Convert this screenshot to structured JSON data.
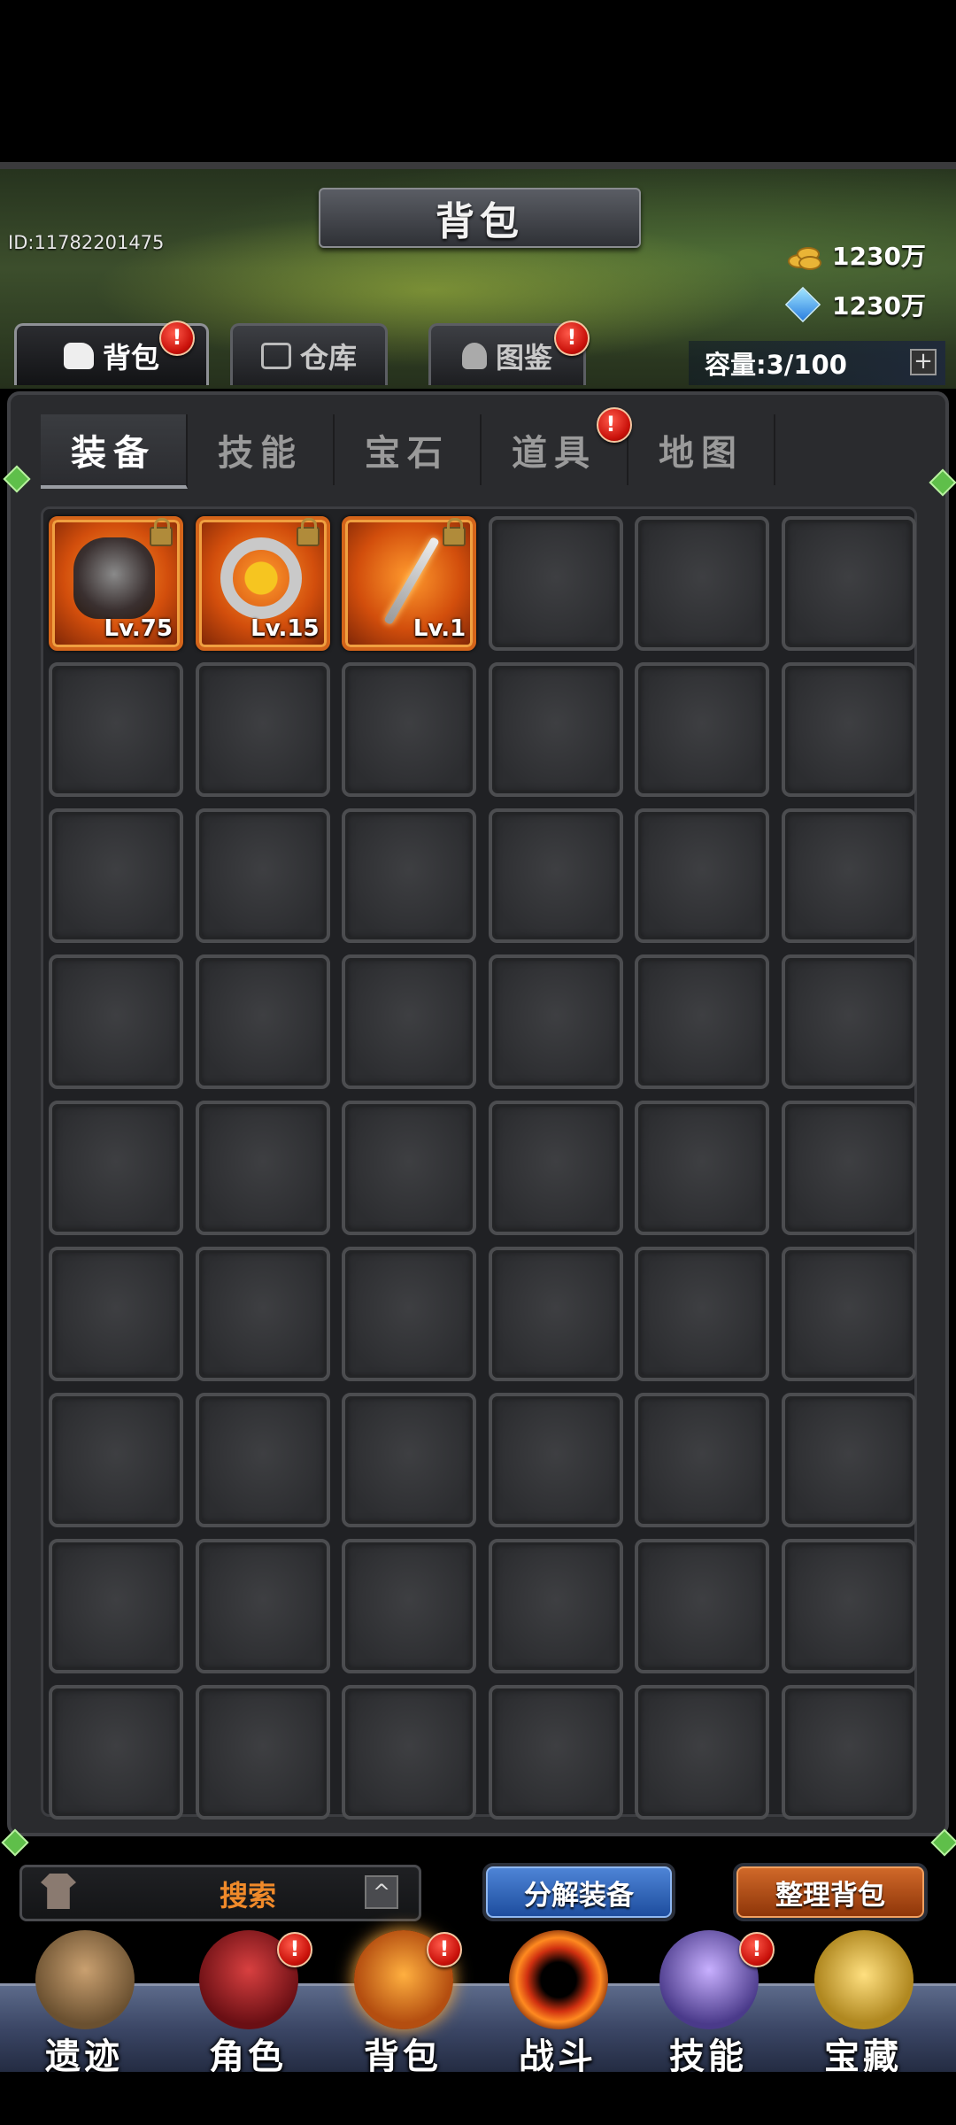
{
  "header": {
    "title": "背包",
    "user_id": "ID:11782201475",
    "gold_amount": "1230万",
    "gem_amount": "1230万",
    "capacity": "容量:3/100",
    "capacity_add": "+"
  },
  "main_tabs": [
    {
      "label": "背包",
      "badge": "!"
    },
    {
      "label": "仓库"
    },
    {
      "label": "图鉴",
      "badge": "!"
    }
  ],
  "sub_tabs": [
    {
      "label": "装备"
    },
    {
      "label": "技能"
    },
    {
      "label": "宝石"
    },
    {
      "label": "道具",
      "badge": "!"
    },
    {
      "label": "地图"
    }
  ],
  "inventory": {
    "items": [
      {
        "name_icon": "armor-icon",
        "level": "Lv.75"
      },
      {
        "name_icon": "ring-icon",
        "level": "Lv.15"
      },
      {
        "name_icon": "sword-icon",
        "level": "Lv.1"
      }
    ],
    "columns": 6,
    "rows": 9
  },
  "actions": {
    "search": "搜索",
    "search_toggle": "^",
    "salvage": "分解装备",
    "sort": "整理背包"
  },
  "nav": [
    {
      "label": "遗迹"
    },
    {
      "label": "角色",
      "badge": "!"
    },
    {
      "label": "背包",
      "badge": "!"
    },
    {
      "label": "战斗"
    },
    {
      "label": "技能",
      "badge": "!"
    },
    {
      "label": "宝藏"
    }
  ],
  "colors": {
    "item_rarity": "#d4641a",
    "badge": "#c9110a",
    "salvage_button": "#2f67c0",
    "sort_button": "#b24e14"
  }
}
